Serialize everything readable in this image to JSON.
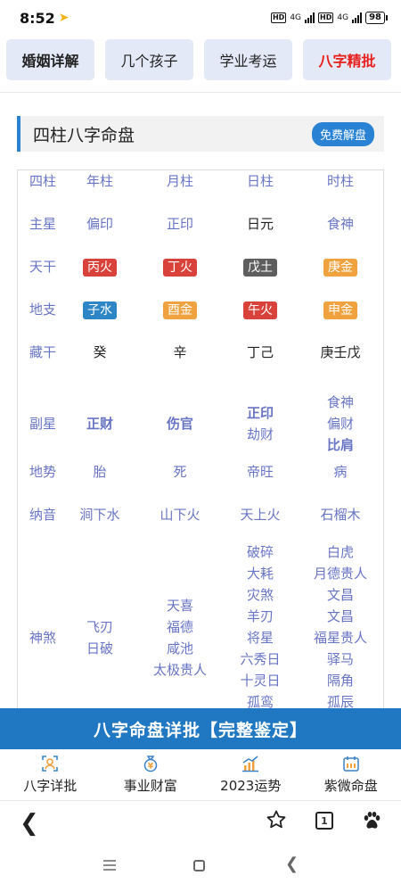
{
  "status": {
    "time": "8:52",
    "network_1": "4G",
    "network_2": "4G",
    "hd": "HD",
    "battery": "98"
  },
  "tabs": [
    {
      "label": "婚姻详解"
    },
    {
      "label": "几个孩子"
    },
    {
      "label": "学业考运"
    },
    {
      "label": "八字精批"
    }
  ],
  "section": {
    "title": "四柱八字命盘",
    "free_button": "免费解盘"
  },
  "table": {
    "header": [
      "四柱",
      "年柱",
      "月柱",
      "日柱",
      "时柱"
    ],
    "zhuxing": {
      "label": "主星",
      "values": [
        "偏印",
        "正印",
        "日元",
        "食神"
      ]
    },
    "tiangan": {
      "label": "天干",
      "values": [
        "丙火",
        "丁火",
        "戊土",
        "庚金"
      ]
    },
    "dizhi": {
      "label": "地支",
      "values": [
        "子水",
        "酉金",
        "午火",
        "申金"
      ]
    },
    "canggan": {
      "label": "藏干",
      "values": [
        "癸",
        "辛",
        "丁己",
        "庚壬戊"
      ]
    },
    "fuxing": {
      "label": "副星",
      "year": "正财",
      "month": "伤官",
      "day": [
        "正印",
        "劫财"
      ],
      "hour": [
        "食神",
        "偏财",
        "比肩"
      ]
    },
    "dishi": {
      "label": "地势",
      "values": [
        "胎",
        "死",
        "帝旺",
        "病"
      ]
    },
    "nayin": {
      "label": "纳音",
      "values": [
        "涧下水",
        "山下火",
        "天上火",
        "石榴木"
      ]
    },
    "shensha": {
      "label": "神煞",
      "year": [
        "飞刃",
        "日破"
      ],
      "month": [
        "天喜",
        "福德",
        "咸池",
        "太极贵人"
      ],
      "day": [
        "破碎",
        "大耗",
        "灾煞",
        "羊刃",
        "将星",
        "六秀日",
        "十灵日",
        "孤鸾"
      ],
      "hour": [
        "白虎",
        "月德贵人",
        "文昌",
        "文昌",
        "福星贵人",
        "驿马",
        "隔角",
        "孤辰"
      ]
    }
  },
  "banner": {
    "label": "八字命盘详批【完整鉴定】"
  },
  "bottom_nav": [
    {
      "label": "八字详批",
      "icon": "person-frame-icon"
    },
    {
      "label": "事业财富",
      "icon": "money-bag-icon"
    },
    {
      "label": "2023运势",
      "icon": "bar-chart-icon"
    },
    {
      "label": "紫微命盘",
      "icon": "calendar-icon"
    }
  ],
  "browser": {
    "tab_count": "1"
  },
  "colors": {
    "accent_blue": "#2a82d4",
    "label_purple": "#6874c4",
    "tab_bg": "#e4e9f7",
    "tab_red": "#e8201d",
    "tag_red": "#d9423a",
    "tag_gray": "#5e5e5e",
    "tag_orange": "#f0a23e",
    "tag_blue": "#2f86c6",
    "banner": "#2078c2"
  }
}
